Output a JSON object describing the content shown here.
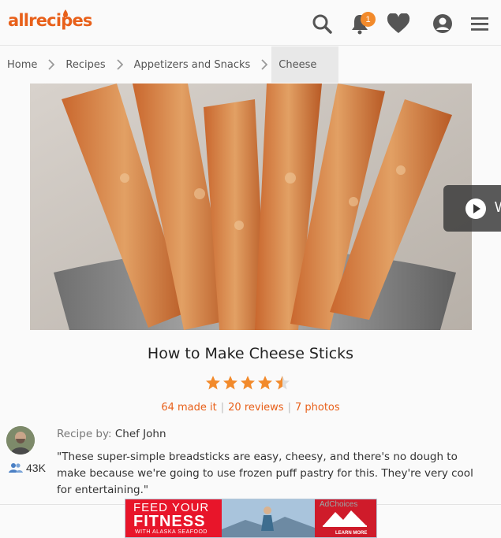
{
  "header": {
    "logo": "allrecipes",
    "notification_count": "1",
    "icons": [
      "search-icon",
      "bell-icon",
      "heart-icon",
      "profile-icon",
      "menu-icon"
    ]
  },
  "breadcrumb": {
    "items": [
      "Home",
      "Recipes",
      "Appetizers and Snacks",
      "Cheese"
    ]
  },
  "video": {
    "label": "W"
  },
  "recipe": {
    "title": "How to Make Cheese Sticks",
    "rating": 4.5,
    "rating_max": 5,
    "made_it": "64 made it",
    "reviews": "20 reviews",
    "photos": "7 photos",
    "recipe_by_label": "Recipe by:",
    "author": "Chef John",
    "followers": "43K",
    "description": "\"These super-simple breadsticks are easy, cheesy, and there's no dough to make because we're going to use frozen puff pastry for this. They're very cool for entertaining.\""
  },
  "ad": {
    "line1": "FEED YOUR",
    "line2": "FITNESS",
    "line3": "WITH ALASKA SEAFOOD",
    "choices": "AdChoices",
    "cta": "LEARN MORE"
  },
  "colors": {
    "brand_orange": "#e8601a",
    "star_orange": "#f28a2b",
    "ad_red": "#e8152a"
  }
}
